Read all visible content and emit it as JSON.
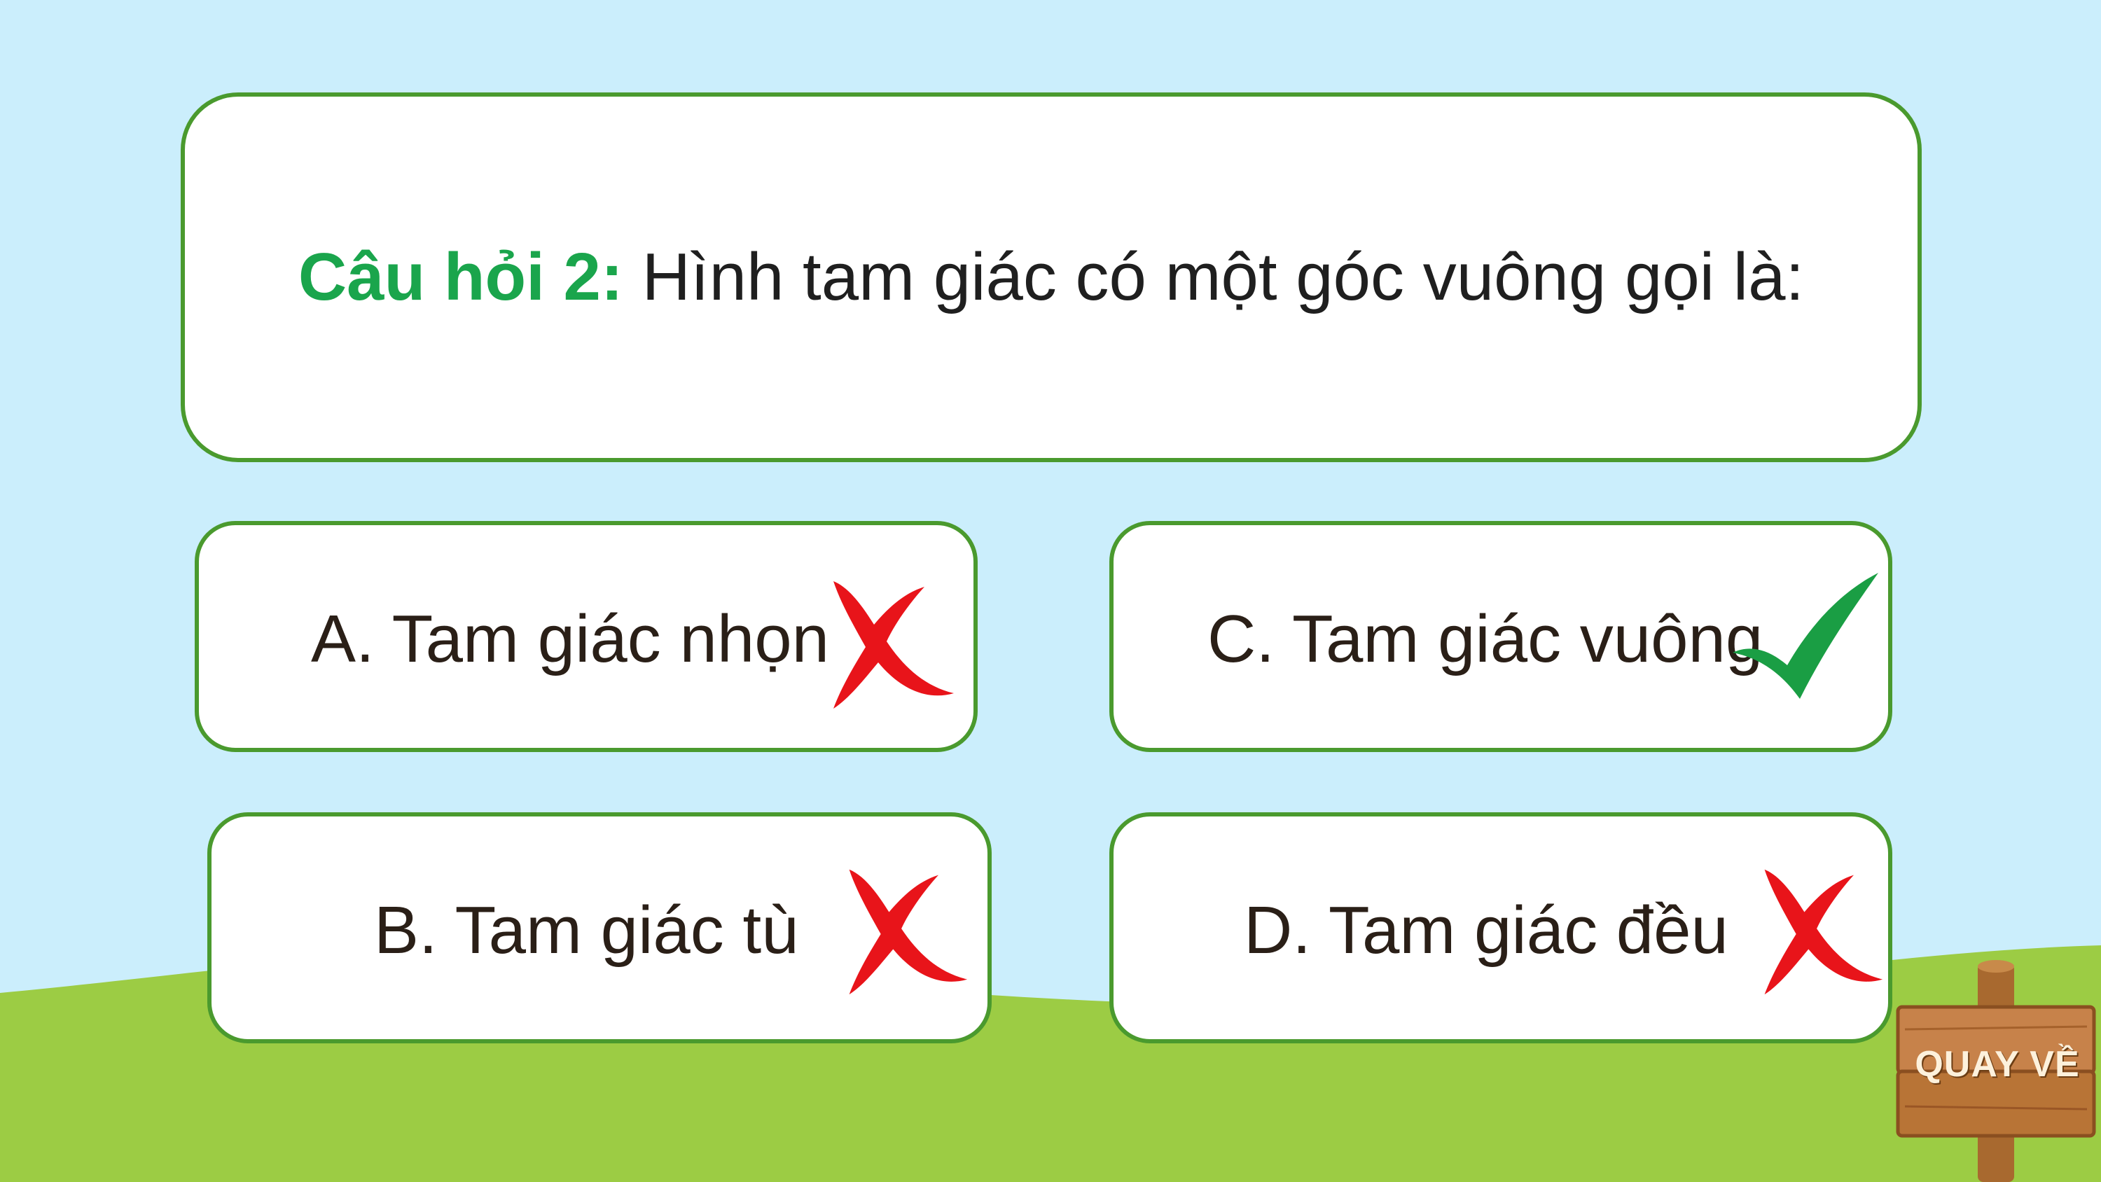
{
  "question": {
    "label": "Câu hỏi 2:",
    "text": "Hình tam giác có một góc vuông gọi là:"
  },
  "answers": [
    {
      "label": "A. Tam giác nhọn",
      "result": "wrong",
      "icon": "red-x-icon"
    },
    {
      "label": "C. Tam giác vuông",
      "result": "correct",
      "icon": "green-check-icon"
    },
    {
      "label": "B. Tam giác tù",
      "result": "wrong",
      "icon": "red-x-icon"
    },
    {
      "label": "D. Tam giác đều",
      "result": "wrong",
      "icon": "red-x-icon"
    }
  ],
  "back_button": {
    "label": "QUAY VỀ",
    "icon": "wooden-sign-icon"
  },
  "colors": {
    "sky": "#cbeefc",
    "grass": "#9ccc44",
    "border": "#4a9a2e",
    "question_label": "#1aa54c",
    "wrong": "#e8141a",
    "correct": "#1a9e44"
  }
}
